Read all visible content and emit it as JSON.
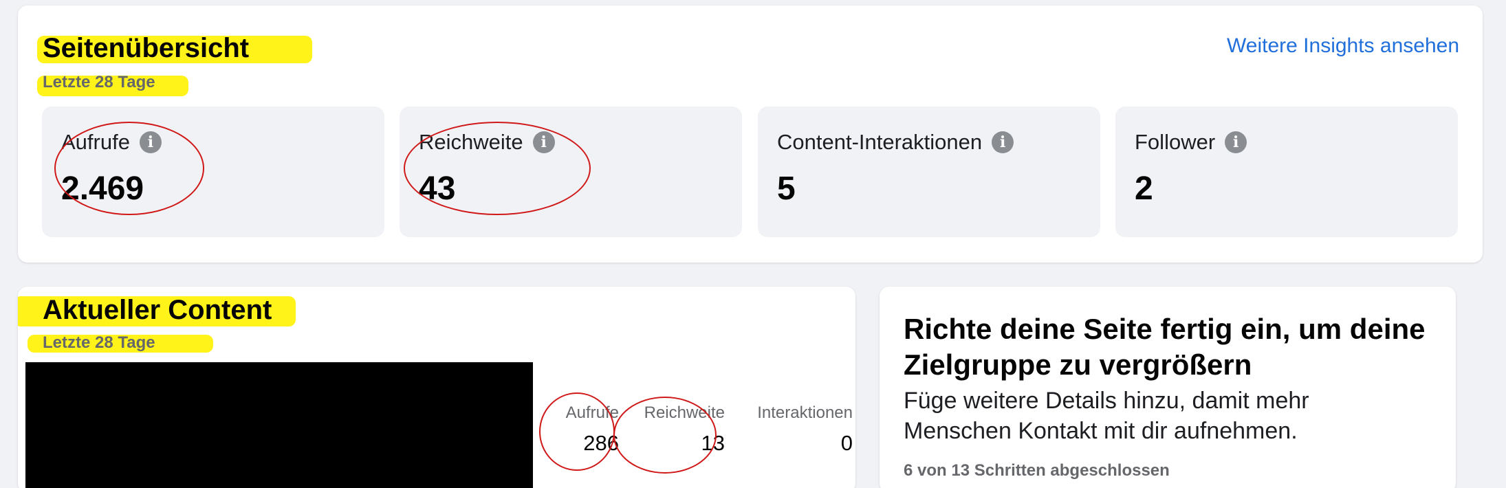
{
  "overview": {
    "title": "Seitenübersicht",
    "subtitle": "Letzte 28 Tage",
    "more_link": "Weitere Insights ansehen",
    "metrics": [
      {
        "label": "Aufrufe",
        "value": "2.469"
      },
      {
        "label": "Reichweite",
        "value": "43"
      },
      {
        "label": "Content-Interaktionen",
        "value": "5"
      },
      {
        "label": "Follower",
        "value": "2"
      }
    ]
  },
  "recent_content": {
    "title": "Aktueller Content",
    "subtitle": "Letzte 28 Tage",
    "post": {
      "stats": [
        {
          "label": "Aufrufe",
          "value": "286"
        },
        {
          "label": "Reichweite",
          "value": "13"
        },
        {
          "label": "Interaktionen",
          "value": "0"
        }
      ]
    }
  },
  "setup": {
    "title": "Richte deine Seite fertig ein, um deine Zielgruppe zu vergrößern",
    "description": "Füge weitere Details hinzu, damit mehr Menschen Kontakt mit dir aufnehmen.",
    "progress": "6 von 13 Schritten abgeschlossen"
  },
  "icons": {
    "info": "info-icon"
  },
  "colors": {
    "highlight": "#fff200",
    "annotation": "#d01818",
    "link": "#216fdb",
    "muted_text": "#65676b"
  }
}
